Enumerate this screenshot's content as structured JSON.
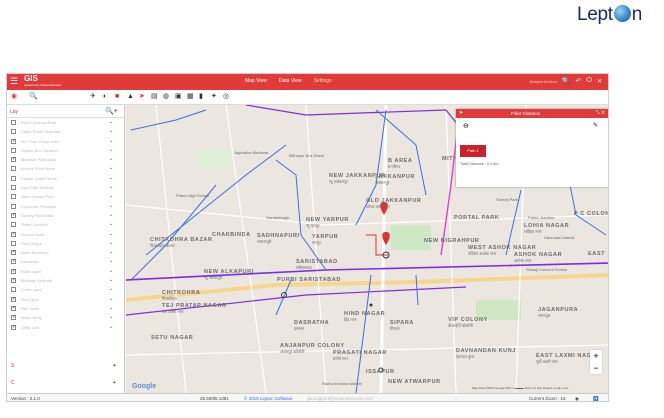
{
  "brand": {
    "text_before": "Lept",
    "text_after": "n"
  },
  "topbar": {
    "logo": "GIS",
    "logo_sub": "powered by NetworkAccess",
    "nav": [
      "Map View",
      "Data View",
      "Settings"
    ],
    "active_nav": "Settings",
    "user_text": "Ariapsa Andrea"
  },
  "sidebar": {
    "tab_label": "Lay",
    "rows": [
      {
        "label": "Fiber Distance Rule",
        "checked": false
      },
      {
        "label": "Cable Route Segment",
        "checked": false
      },
      {
        "label": "OLT Pole Group Adm",
        "checked": true
      },
      {
        "label": "Splitter Box Location",
        "checked": false
      },
      {
        "label": "Manhole Point Data",
        "checked": true
      },
      {
        "label": "Access Point Node",
        "checked": false
      },
      {
        "label": "Feeder Cable Route",
        "checked": false
      },
      {
        "label": "Duct Path Network",
        "checked": false
      },
      {
        "label": "Joint Closure Point",
        "checked": false
      },
      {
        "label": "Customer Premises",
        "checked": false
      },
      {
        "label": "Survey Point Data",
        "checked": true
      },
      {
        "label": "Tower Location",
        "checked": false
      },
      {
        "label": "Service Area",
        "checked": true
      },
      {
        "label": "Pole Height",
        "checked": false
      },
      {
        "label": "Ward Boundary",
        "checked": true
      },
      {
        "label": "Landmark",
        "checked": true
      },
      {
        "label": "Road Layer",
        "checked": true
      },
      {
        "label": "Building Footprint",
        "checked": true
      },
      {
        "label": "Zone Layer",
        "checked": false
      },
      {
        "label": "Plot Layer",
        "checked": true
      },
      {
        "label": "Rail Track",
        "checked": true
      },
      {
        "label": "Water Body",
        "checked": true
      },
      {
        "label": "Utility Line",
        "checked": true
      }
    ],
    "foot1": "S",
    "foot2": "C"
  },
  "panel": {
    "title": "Fiber Distance",
    "path_label": "Path 1",
    "total_distance": "Total Distance : 0.4 km"
  },
  "map": {
    "places": [
      {
        "text": "B AREA",
        "sub": "ब एरिया"
      },
      {
        "text": "MITHA",
        "sub": ""
      },
      {
        "text": "NEW JAKKANPUR",
        "sub": "न्यू जक्कनपुर"
      },
      {
        "text": "JAKKANPUR",
        "sub": "जक्कनपुर"
      },
      {
        "text": "OLD JAKKANPUR",
        "sub": "ओल्ड जक्कनपुर"
      },
      {
        "text": "NEW YARPUR",
        "sub": "न्यू यारपुर"
      },
      {
        "text": "PORTAL PARK",
        "sub": ""
      },
      {
        "text": "LOHIA NAGAR",
        "sub": "लोहिया नगर"
      },
      {
        "text": "P C COLONY",
        "sub": ""
      },
      {
        "text": "CHITKOHRA BAZAR",
        "sub": "चितकोहरा बाजार"
      },
      {
        "text": "CHAKBINDA",
        "sub": ""
      },
      {
        "text": "SADHNAPURI",
        "sub": "साधनापुरी"
      },
      {
        "text": "YARPUR",
        "sub": "यारपुर"
      },
      {
        "text": "NEW BIGRAHPUR",
        "sub": ""
      },
      {
        "text": "WEST ASHOK NAGAR",
        "sub": "पश्चिम अशोक नगर"
      },
      {
        "text": "ASHOK NAGAR",
        "sub": "अशोक नगर"
      },
      {
        "text": "EAST",
        "sub": ""
      },
      {
        "text": "NEW ALKAPURI",
        "sub": "न्यू अल्कापुरी"
      },
      {
        "text": "SARISTABAD",
        "sub": "सरिस्ताबाद"
      },
      {
        "text": "PURBI SARISTABAD",
        "sub": ""
      },
      {
        "text": "CHITKOHRA",
        "sub": "चितकोहरा"
      },
      {
        "text": "TEJ PRATAP NAGAR",
        "sub": "तेज प्रताप नगर"
      },
      {
        "text": "SETU NAGAR",
        "sub": ""
      },
      {
        "text": "DASRATHA",
        "sub": "दसरथा"
      },
      {
        "text": "HIND NAGAR",
        "sub": "हिंद नगर"
      },
      {
        "text": "SIPARA",
        "sub": "सिपारा"
      },
      {
        "text": "VIP COLONY",
        "sub": "वीआईपी कॉलोनी"
      },
      {
        "text": "JAGANPURA",
        "sub": "जगनपुरा"
      },
      {
        "text": "ANJANPUR COLONY",
        "sub": "अंजनपुर कॉलोनी"
      },
      {
        "text": "PRAGATI NAGAR",
        "sub": "प्रगति नगर"
      },
      {
        "text": "DAVNANDAN KUNJ",
        "sub": "देवनंदन कुंज"
      },
      {
        "text": "EAST LAXMI NAGAR",
        "sub": "पूर्वी लक्ष्मी नगर"
      },
      {
        "text": "ISSAPUR",
        "sub": ""
      },
      {
        "text": "NEW ATWARPUR",
        "sub": ""
      },
      {
        "text": "Patna High School",
        "sub": ""
      },
      {
        "text": "Gardanibagh",
        "sub": ""
      },
      {
        "text": "Radha Krishna Mandir",
        "sub": ""
      },
      {
        "text": "Hanuman Mandir",
        "sub": ""
      },
      {
        "text": "Shivaji Convent School",
        "sub": ""
      },
      {
        "text": "Jaiprabha Medanta",
        "sub": ""
      },
      {
        "text": "Mithapur Bus Stand",
        "sub": ""
      },
      {
        "text": "Patna Junction",
        "sub": ""
      },
      {
        "text": "Shreeji Park",
        "sub": ""
      }
    ],
    "attribution": "Map data ©2019 Google   200 m ▬▬▬   Terms of Use   Report a map error",
    "google": "Google"
  },
  "status": {
    "version": "Version : 2.1.0",
    "coords": "25.59/85.1381",
    "copyright": "© 2019 Lepton Software",
    "email": "gis.support@networkaccess.com",
    "zoom": "Current Zoom : 15"
  },
  "colors": {
    "accent": "#e03a3a",
    "panel_path": "#c8232c",
    "route_blue": "#3b6fe0",
    "route_purple": "#7a2fe0"
  }
}
